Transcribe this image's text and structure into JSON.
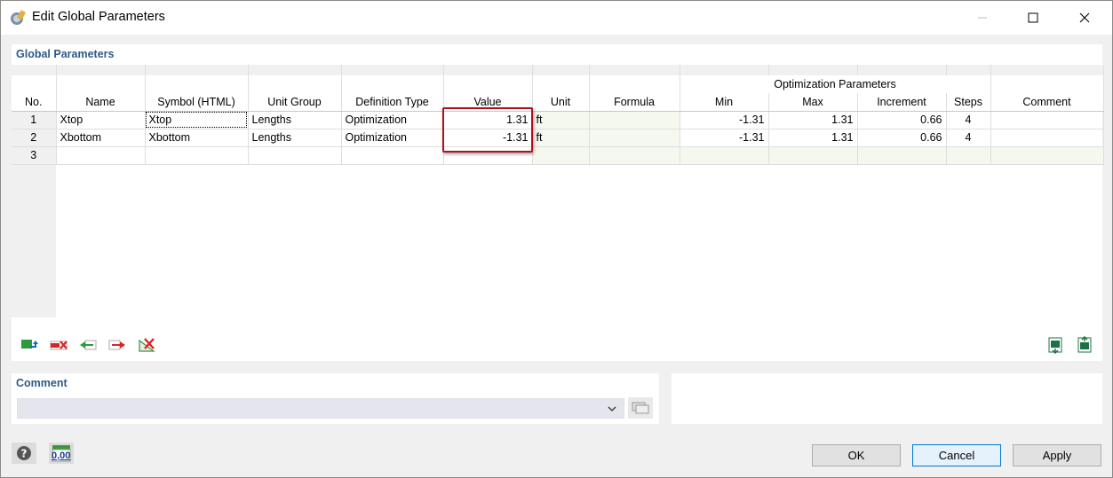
{
  "window": {
    "title": "Edit Global Parameters",
    "controls": [
      "minimize-icon",
      "maximize-icon",
      "close-icon"
    ]
  },
  "global_parameters": {
    "header": "Global Parameters",
    "group_header": "Optimization Parameters",
    "columns": [
      "No.",
      "Name",
      "Symbol (HTML)",
      "Unit Group",
      "Definition Type",
      "Value",
      "Unit",
      "Formula",
      "Min",
      "Max",
      "Increment",
      "Steps",
      "Comment"
    ],
    "rows": [
      {
        "no": "1",
        "name": "Xtop",
        "symbol": "Xtop",
        "unit_group": "Lengths",
        "definition_type": "Optimization",
        "value": "1.31",
        "unit": "ft",
        "formula": "",
        "min": "-1.31",
        "max": "1.31",
        "increment": "0.66",
        "steps": "4",
        "comment": ""
      },
      {
        "no": "2",
        "name": "Xbottom",
        "symbol": "Xbottom",
        "unit_group": "Lengths",
        "definition_type": "Optimization",
        "value": "-1.31",
        "unit": "ft",
        "formula": "",
        "min": "-1.31",
        "max": "1.31",
        "increment": "0.66",
        "steps": "4",
        "comment": ""
      },
      {
        "no": "3",
        "name": "",
        "symbol": "",
        "unit_group": "",
        "definition_type": "",
        "value": "",
        "unit": "",
        "formula": "",
        "min": "",
        "max": "",
        "increment": "",
        "steps": "",
        "comment": ""
      }
    ],
    "toolbar_icons": [
      "insert-row-icon",
      "delete-row-icon",
      "move-left-icon",
      "move-right-icon",
      "delete-all-icon"
    ],
    "export_icons": [
      "export-excel-icon",
      "import-excel-icon"
    ]
  },
  "comment": {
    "header": "Comment",
    "value": ""
  },
  "footer": {
    "ok_label": "OK",
    "cancel_label": "Cancel",
    "apply_label": "Apply",
    "units_icon_text": "0,00"
  },
  "colors": {
    "header_text": "#2e5a8a",
    "highlight_box": "#b00f1d",
    "focus_border": "#0078d7"
  }
}
